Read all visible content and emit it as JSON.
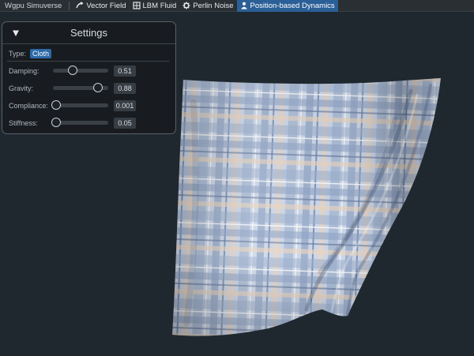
{
  "app": {
    "title": "Wgpu Simuverse"
  },
  "tabs": [
    {
      "label": "Vector Field",
      "icon": "vector-field-icon",
      "active": false
    },
    {
      "label": "LBM Fluid",
      "icon": "fluid-icon",
      "active": false
    },
    {
      "label": "Perlin Noise",
      "icon": "gear-icon",
      "active": false
    },
    {
      "label": "Position-based Dynamics",
      "icon": "pbd-icon",
      "active": true
    }
  ],
  "settings": {
    "title": "Settings",
    "type_label": "Type:",
    "type_value": "Cloth",
    "sliders": [
      {
        "label": "Damping:",
        "value": "0.51",
        "fraction": 0.35
      },
      {
        "label": "Gravity:",
        "value": "0.88",
        "fraction": 0.82
      },
      {
        "label": "Compliance:",
        "value": "0.001",
        "fraction": 0.06
      },
      {
        "label": "Stiffness:",
        "value": "0.05",
        "fraction": 0.06
      }
    ]
  },
  "colors": {
    "accent": "#2b5f97",
    "background": "#1f282f",
    "cloth_base": "#c9d4e6",
    "cloth_stripe_blue": "#7d93b8",
    "cloth_stripe_peach": "#e7cdb6"
  }
}
